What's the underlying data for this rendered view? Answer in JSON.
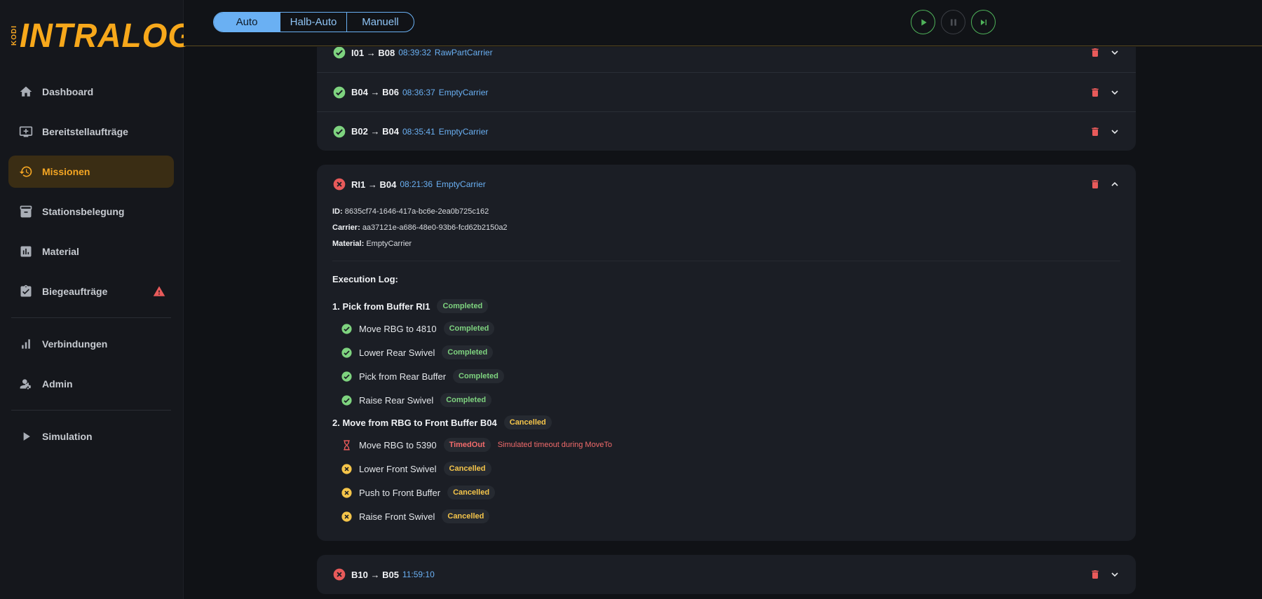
{
  "brand": {
    "kodi": "KODI",
    "name": "INTRALOG"
  },
  "sidebar": {
    "items": [
      {
        "label": "Dashboard",
        "icon": "home-icon"
      },
      {
        "label": "Bereitstellaufträge",
        "icon": "queue-add-icon"
      },
      {
        "label": "Missionen",
        "icon": "history-icon",
        "active": true
      },
      {
        "label": "Stationsbelegung",
        "icon": "archive-icon"
      },
      {
        "label": "Material",
        "icon": "bar-chart-icon"
      },
      {
        "label": "Biegeaufträge",
        "icon": "clipboard-check-icon",
        "warning": true
      }
    ],
    "items2": [
      {
        "label": "Verbindungen",
        "icon": "signal-icon"
      },
      {
        "label": "Admin",
        "icon": "admin-icon"
      }
    ],
    "items3": [
      {
        "label": "Simulation",
        "icon": "play-icon"
      }
    ]
  },
  "topbar": {
    "modes": [
      "Auto",
      "Halb-Auto",
      "Manuell"
    ],
    "active_mode": "Auto"
  },
  "colors": {
    "accent": "#f5a623",
    "blue": "#6ab0f3",
    "green": "#4fb35a",
    "red": "#e85a5a",
    "yellow": "#f5c54a"
  },
  "missions": {
    "group1": [
      {
        "status": "success",
        "from": "I01",
        "to": "B08",
        "arrow": "→",
        "time": "08:39:32",
        "type": "RawPartCarrier"
      },
      {
        "status": "success",
        "from": "B04",
        "to": "B06",
        "arrow": "→",
        "time": "08:36:37",
        "type": "EmptyCarrier"
      },
      {
        "status": "success",
        "from": "B02",
        "to": "B04",
        "arrow": "→",
        "time": "08:35:41",
        "type": "EmptyCarrier"
      }
    ],
    "expanded": {
      "status": "failed",
      "route": "RI1 → B04",
      "time": "08:21:36",
      "type": "EmptyCarrier",
      "id_label": "ID:",
      "id": "8635cf74-1646-417a-bc6e-2ea0b725c162",
      "carrier_label": "Carrier:",
      "carrier": "aa37121e-a686-48e0-93b6-fcd62b2150a2",
      "material_label": "Material:",
      "material": "EmptyCarrier",
      "log_title": "Execution Log:",
      "steps": [
        {
          "title": "1. Pick from Buffer RI1",
          "status": "Completed",
          "subs": [
            {
              "label": "Move RBG to 4810",
              "status": "Completed"
            },
            {
              "label": "Lower Rear Swivel",
              "status": "Completed"
            },
            {
              "label": "Pick from Rear Buffer",
              "status": "Completed"
            },
            {
              "label": "Raise Rear Swivel",
              "status": "Completed"
            }
          ]
        },
        {
          "title": "2. Move from RBG to Front Buffer B04",
          "status": "Cancelled",
          "subs": [
            {
              "label": "Move RBG to 5390",
              "status": "TimedOut",
              "message": "Simulated timeout during MoveTo"
            },
            {
              "label": "Lower Front Swivel",
              "status": "Cancelled"
            },
            {
              "label": "Push to Front Buffer",
              "status": "Cancelled"
            },
            {
              "label": "Raise Front Swivel",
              "status": "Cancelled"
            }
          ]
        }
      ]
    },
    "last": {
      "status": "failed",
      "route": "B10 → B05",
      "time": "11:59:10"
    }
  }
}
